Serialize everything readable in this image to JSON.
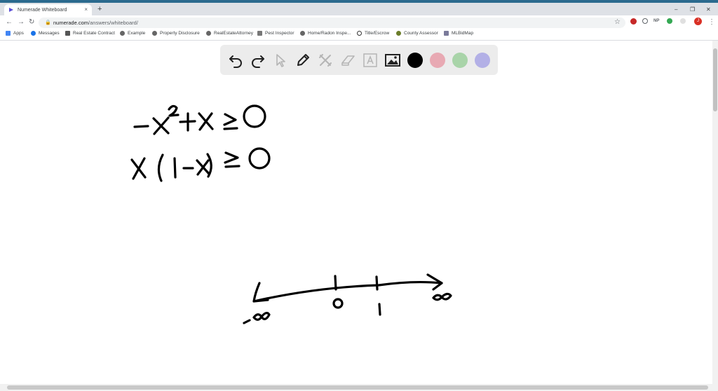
{
  "browser": {
    "tab_title": "Numerade Whiteboard",
    "tab_close": "×",
    "new_tab": "+",
    "url_host": "numerade.com",
    "url_path": "/answers/whiteboard/",
    "window_controls": [
      "–",
      "❐",
      "✕"
    ],
    "extensions": [
      "NP"
    ],
    "profile_initial": "J",
    "profile_color": "#d93025"
  },
  "bookmarks": [
    {
      "label": "Apps",
      "icon": "apps-grid-icon"
    },
    {
      "label": "Messages",
      "icon": "messages-icon"
    },
    {
      "label": "Real Estate Contract",
      "icon": "document-icon"
    },
    {
      "label": "Example",
      "icon": "globe-icon"
    },
    {
      "label": "Property Disclosure",
      "icon": "globe-icon"
    },
    {
      "label": "RealEstateAttorney",
      "icon": "globe-icon"
    },
    {
      "label": "Pest Inspector",
      "icon": "pest-icon"
    },
    {
      "label": "Home/Radon Inspe...",
      "icon": "globe-icon"
    },
    {
      "label": "Title/Escrow",
      "icon": "title-icon"
    },
    {
      "label": "County Assessor",
      "icon": "county-icon"
    },
    {
      "label": "MLBidMap",
      "icon": "map-icon"
    }
  ],
  "toolbar": {
    "tools": [
      "undo-icon",
      "redo-icon",
      "pointer-icon",
      "pen-icon",
      "tools-icon",
      "eraser-icon",
      "text-icon",
      "image-icon"
    ],
    "colors": [
      "#000000",
      "#e8a9b3",
      "#a9d4a9",
      "#b3b0e6"
    ]
  },
  "whiteboard": {
    "note": "handwritten ink strokes: -x^2 + x >= 0 ; x(1-x) >= 0 ; number line with -∞, 0, 1, ∞"
  }
}
